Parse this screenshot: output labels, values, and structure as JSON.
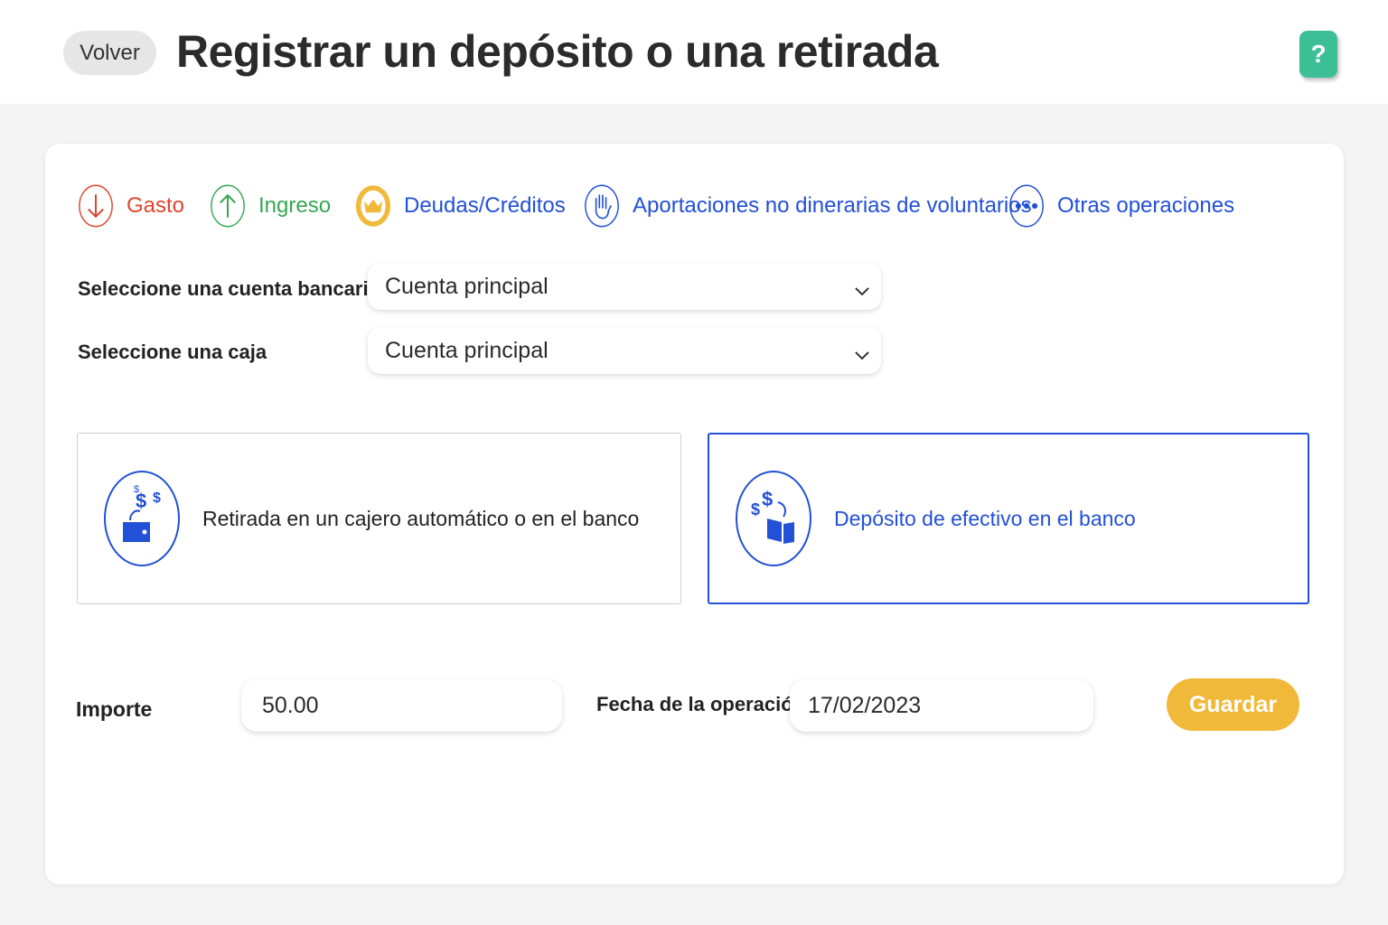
{
  "header": {
    "back_label": "Volver",
    "title": "Registrar un depósito o una retirada",
    "help_label": "?"
  },
  "operations": [
    {
      "label": "Gasto",
      "color": "#e0452e",
      "icon": "arrow-down-icon"
    },
    {
      "label": "Ingreso",
      "color": "#36a852",
      "icon": "arrow-up-icon"
    },
    {
      "label": "Deudas/Créditos",
      "color": "#f0b93a",
      "icon": "crown-icon"
    },
    {
      "label": "Aportaciones no dinerarias de voluntarios",
      "color": "#2250d6",
      "icon": "hand-icon"
    },
    {
      "label": "Otras operaciones",
      "color": "#2250d6",
      "icon": "more-dots-icon"
    }
  ],
  "form": {
    "bank_account_label": "Seleccione una cuenta bancaria",
    "bank_account_value": "Cuenta principal",
    "cash_box_label": "Seleccione una caja",
    "cash_box_value": "Cuenta principal",
    "amount_label": "Importe",
    "amount_value": "50.00",
    "date_label": "Fecha de la operación",
    "date_value": "17/02/2023",
    "save_label": "Guardar"
  },
  "types": [
    {
      "label": "Retirada en un cajero automático o en el banco",
      "selected": false,
      "icon": "atm-withdrawal-icon"
    },
    {
      "label": "Depósito de efectivo en el banco",
      "selected": true,
      "icon": "bank-deposit-icon"
    }
  ],
  "colors": {
    "accent": "#2250d6",
    "help": "#3dbf95",
    "save": "#f0b93a"
  }
}
